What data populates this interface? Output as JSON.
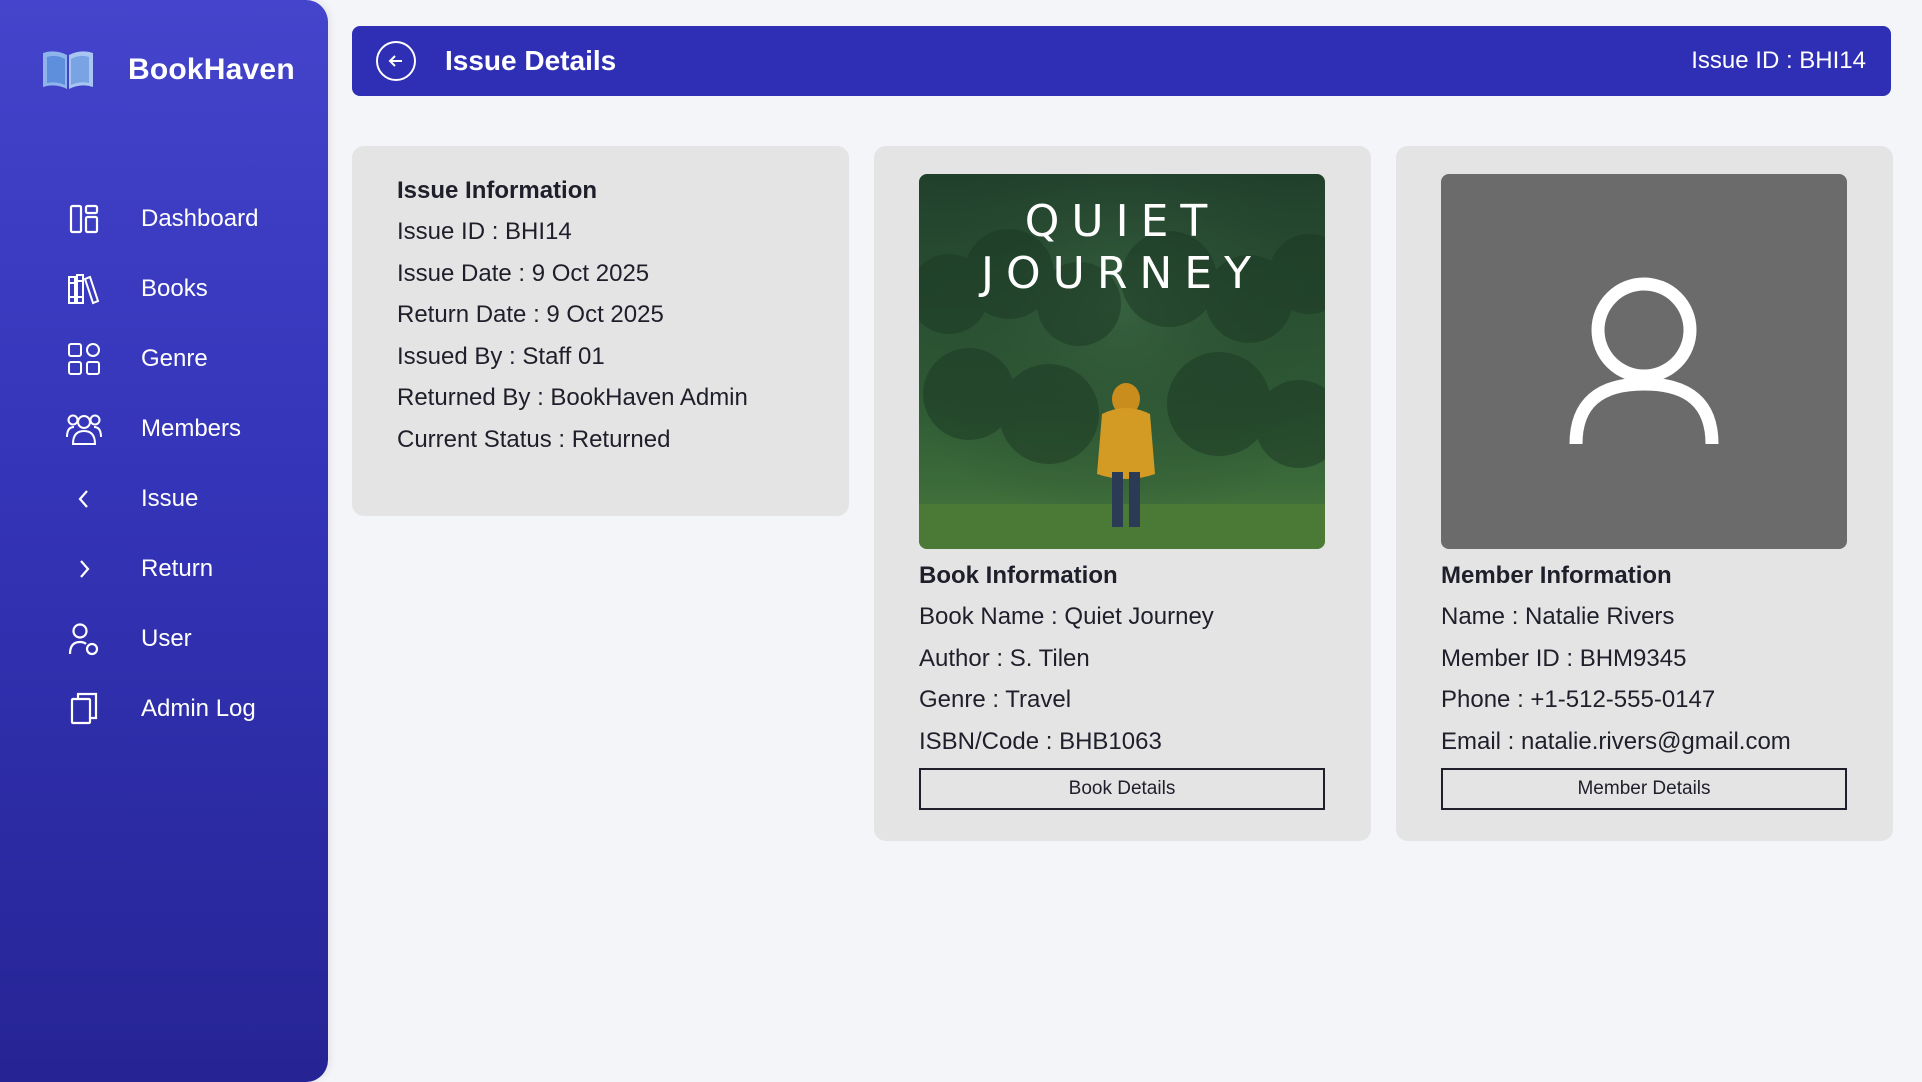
{
  "app": {
    "name": "BookHaven",
    "logo_icon": "open-book-icon"
  },
  "colors": {
    "sidebar_top": "#4444cc",
    "sidebar_bottom": "#262494",
    "header_bg": "#2f2fb5",
    "card_bg": "#e4e4e4",
    "page_bg": "#f4f5f9",
    "avatar_bg": "#6b6b6b"
  },
  "sidebar": {
    "items": [
      {
        "label": "Dashboard",
        "icon": "dashboard-icon"
      },
      {
        "label": "Books",
        "icon": "books-icon"
      },
      {
        "label": "Genre",
        "icon": "genre-grid-icon"
      },
      {
        "label": "Members",
        "icon": "members-icon"
      },
      {
        "label": "Issue",
        "icon": "chevron-left-icon"
      },
      {
        "label": "Return",
        "icon": "chevron-right-icon"
      },
      {
        "label": "User",
        "icon": "user-settings-icon"
      },
      {
        "label": "Admin Log",
        "icon": "admin-log-icon"
      }
    ]
  },
  "header": {
    "title": "Issue Details",
    "issue_id": "Issue ID : BHI14",
    "back_icon": "arrow-left-circle-icon"
  },
  "issue_info": {
    "title": "Issue Information",
    "lines": [
      "Issue ID : BHI14",
      "Issue Date : 9 Oct 2025",
      "Return Date : 9 Oct 2025",
      "Issued By : Staff 01",
      "Returned By : BookHaven Admin",
      "Current Status : Returned"
    ]
  },
  "book_info": {
    "cover_title_line1": "QUIET",
    "cover_title_line2": "JOURNEY",
    "title": "Book Information",
    "lines": [
      "Book Name : Quiet Journey",
      "Author : S. Tilen",
      "Genre : Travel",
      "ISBN/Code : BHB1063"
    ],
    "button": "Book Details"
  },
  "member_info": {
    "avatar_icon": "user-placeholder-icon",
    "title": "Member Information",
    "lines": [
      "Name : Natalie Rivers",
      "Member ID : BHM9345",
      "Phone : +1-512-555-0147",
      "Email : natalie.rivers@gmail.com"
    ],
    "button": "Member Details"
  }
}
